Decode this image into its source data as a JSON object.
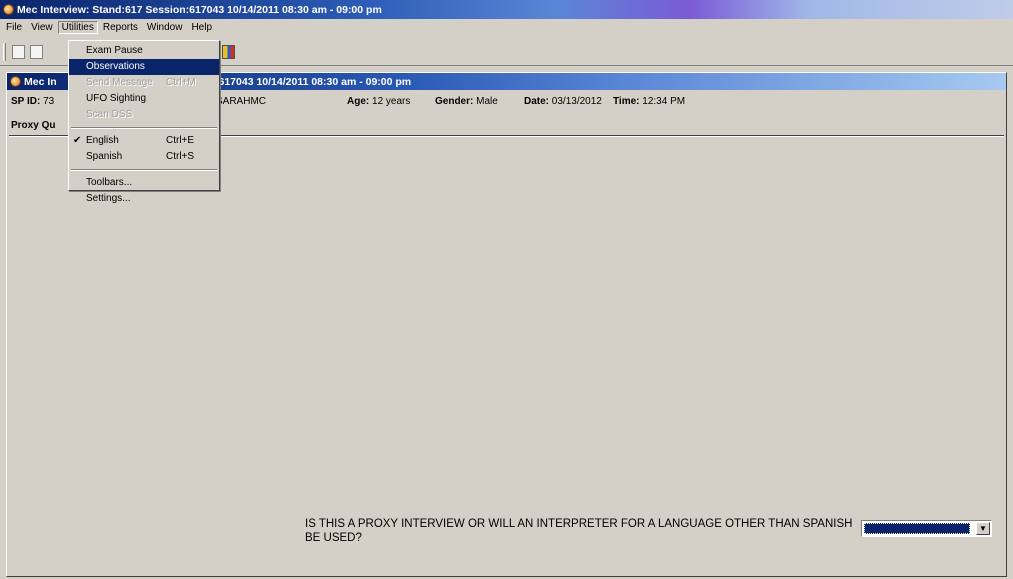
{
  "window": {
    "title": "Mec Interview: Stand:617 Session:617043 10/14/2011 08:30 am - 09:00 pm"
  },
  "menubar": {
    "items": [
      "File",
      "View",
      "Utilities",
      "Reports",
      "Window",
      "Help"
    ],
    "active": "Utilities"
  },
  "utilities_menu": {
    "items": [
      {
        "label": "Exam Pause",
        "shortcut": "",
        "state": "normal",
        "checked": false
      },
      {
        "label": "Observations",
        "shortcut": "",
        "state": "highlighted",
        "checked": false
      },
      {
        "label": "Send Message",
        "shortcut": "Ctrl+M",
        "state": "disabled",
        "checked": false
      },
      {
        "label": "UFO Sighting",
        "shortcut": "",
        "state": "normal",
        "checked": false
      },
      {
        "label": "Scan DSS",
        "shortcut": "",
        "state": "disabled",
        "checked": false
      },
      {
        "label": "English",
        "shortcut": "Ctrl+E",
        "state": "normal",
        "checked": true
      },
      {
        "label": "Spanish",
        "shortcut": "Ctrl+S",
        "state": "normal",
        "checked": false
      },
      {
        "label": "Toolbars...",
        "shortcut": "",
        "state": "normal",
        "checked": false
      },
      {
        "label": "Settings...",
        "shortcut": "",
        "state": "normal",
        "checked": false
      }
    ],
    "check_glyph": "✔"
  },
  "child_window": {
    "title_visible": ":617043 10/14/2011 08:30 am - 09:00 pm",
    "title_prefix": "Mec In"
  },
  "info": {
    "sp_id_label": "SP ID:",
    "sp_id_value": "73",
    "user": "SARAHMC",
    "age_label": "Age:",
    "age_value": "12 years",
    "gender_label": "Gender:",
    "gender_value": "Male",
    "date_label": "Date:",
    "date_value": "03/13/2012",
    "time_label": "Time:",
    "time_value": "12:34 PM"
  },
  "section": {
    "label": "Proxy Qu"
  },
  "question": {
    "text": "IS THIS A PROXY INTERVIEW OR WILL AN INTERPRETER FOR A LANGUAGE OTHER THAN SPANISH BE USED?",
    "answer_value": ""
  },
  "icons": {
    "combo_arrow": "▼",
    "app": "app-icon"
  }
}
